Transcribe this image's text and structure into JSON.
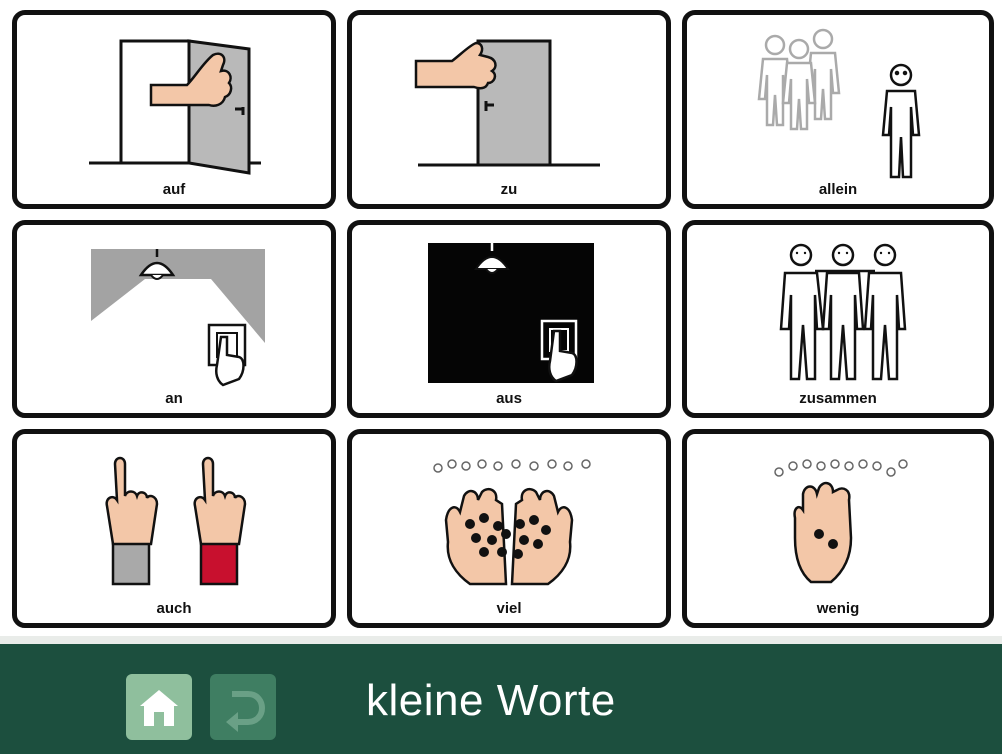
{
  "board": {
    "cards": [
      {
        "label": "auf",
        "icon": "door-open-icon"
      },
      {
        "label": "zu",
        "icon": "door-closed-icon"
      },
      {
        "label": "allein",
        "icon": "alone-person-icon"
      },
      {
        "label": "an",
        "icon": "light-on-icon"
      },
      {
        "label": "aus",
        "icon": "light-off-icon"
      },
      {
        "label": "zusammen",
        "icon": "together-people-icon"
      },
      {
        "label": "auch",
        "icon": "raised-fingers-icon"
      },
      {
        "label": "viel",
        "icon": "many-balls-hands-icon"
      },
      {
        "label": "wenig",
        "icon": "few-balls-hand-icon"
      }
    ]
  },
  "bar": {
    "title": "kleine Worte",
    "home_icon": "home-icon",
    "back_icon": "back-arrow-icon",
    "background": "#1c4f3e",
    "home_color": "#8fbf9d",
    "back_color": "#3f7e62"
  }
}
